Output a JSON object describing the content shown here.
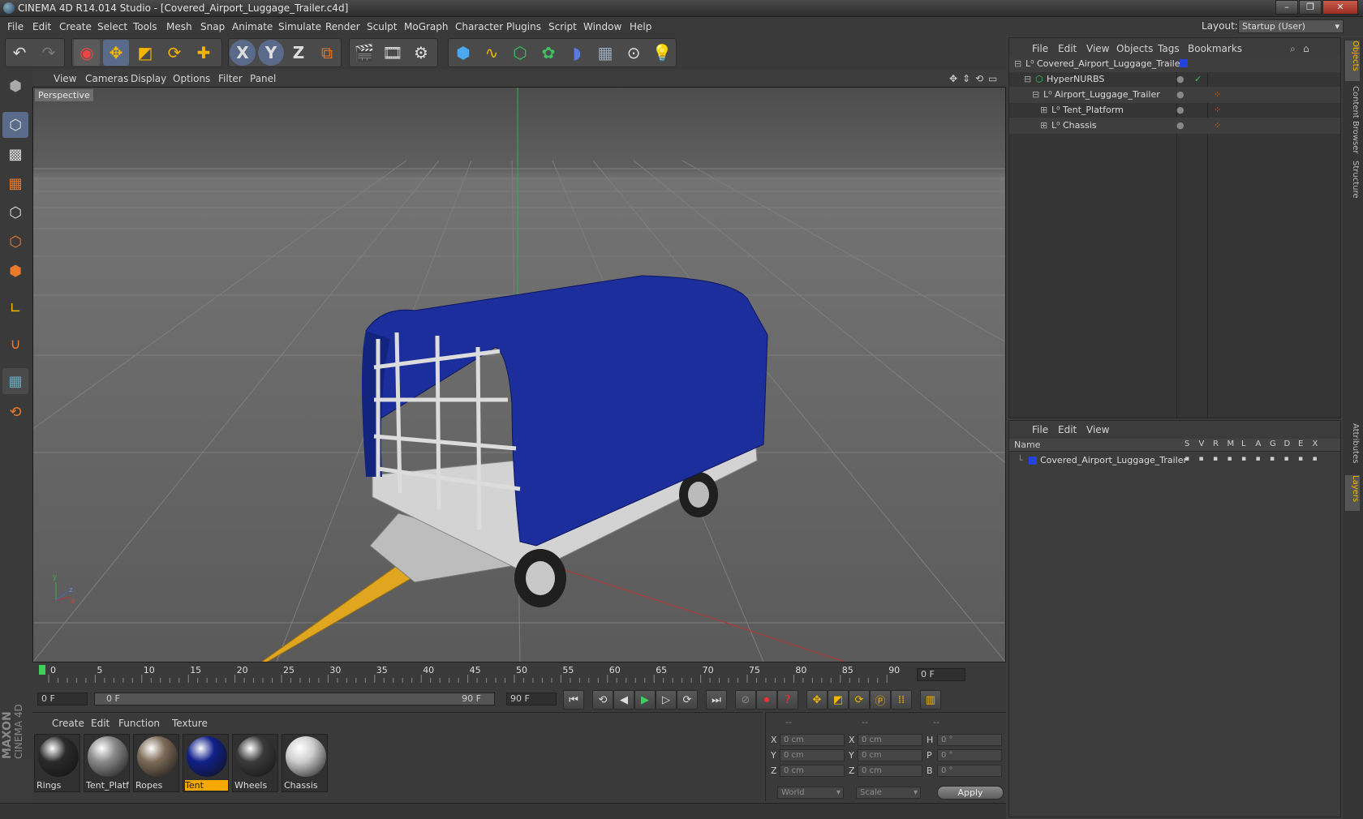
{
  "window": {
    "title": "CINEMA 4D R14.014 Studio - [Covered_Airport_Luggage_Trailer.c4d]"
  },
  "menu": [
    "File",
    "Edit",
    "Create",
    "Select",
    "Tools",
    "Mesh",
    "Snap",
    "Animate",
    "Simulate",
    "Render",
    "Sculpt",
    "MoGraph",
    "Character",
    "Plugins",
    "Script",
    "Window",
    "Help"
  ],
  "layout": {
    "label": "Layout:",
    "value": "Startup (User)"
  },
  "toolbar": {
    "x_label": "X",
    "y_label": "Y",
    "z_label": "Z"
  },
  "viewport": {
    "menu": [
      "View",
      "Cameras",
      "Display",
      "Options",
      "Filter",
      "Panel"
    ],
    "label": "Perspective",
    "axes": {
      "x": "x",
      "y": "y",
      "z": "z"
    }
  },
  "timeline": {
    "ticks": [
      "0",
      "5",
      "10",
      "15",
      "20",
      "25",
      "30",
      "35",
      "40",
      "45",
      "50",
      "55",
      "60",
      "65",
      "70",
      "75",
      "80",
      "85",
      "90"
    ],
    "current_frame": "0 F"
  },
  "transport": {
    "start": "0 F",
    "range_start": "0 F",
    "range_end": "90 F",
    "end": "90 F"
  },
  "materials": {
    "menu": [
      "Create",
      "Edit",
      "Function",
      "Texture"
    ],
    "items": [
      {
        "name": "Rings",
        "color": "#2a2a2a",
        "selected": false
      },
      {
        "name": "Tent_Platfo",
        "color": "#8a8a8a",
        "selected": false
      },
      {
        "name": "Ropes",
        "color": "#7d6b58",
        "selected": false
      },
      {
        "name": "Tent",
        "color": "#10208a",
        "selected": true
      },
      {
        "name": "Wheels",
        "color": "#3a3a3a",
        "selected": false
      },
      {
        "name": "Chassis",
        "color": "#cfcfcf",
        "selected": false
      }
    ]
  },
  "coords": {
    "headers": [
      "--",
      "--",
      "--"
    ],
    "pos": [
      {
        "axis": "X",
        "val": "0 cm"
      },
      {
        "axis": "Y",
        "val": "0 cm"
      },
      {
        "axis": "Z",
        "val": "0 cm"
      }
    ],
    "size": [
      {
        "axis": "X",
        "val": "0 cm"
      },
      {
        "axis": "Y",
        "val": "0 cm"
      },
      {
        "axis": "Z",
        "val": "0 cm"
      }
    ],
    "rot": [
      {
        "axis": "H",
        "val": "0 °"
      },
      {
        "axis": "P",
        "val": "0 °"
      },
      {
        "axis": "B",
        "val": "0 °"
      }
    ],
    "mode1": "World",
    "mode2": "Scale",
    "apply": "Apply"
  },
  "objects": {
    "menu": [
      "File",
      "Edit",
      "View",
      "Objects",
      "Tags",
      "Bookmarks"
    ],
    "rows": [
      {
        "name": "Covered_Airport_Luggage_Trailer"
      },
      {
        "name": "HyperNURBS"
      },
      {
        "name": "Airport_Luggage_Trailer"
      },
      {
        "name": "Tent_Platform"
      },
      {
        "name": "Chassis"
      }
    ]
  },
  "layers": {
    "menu": [
      "File",
      "Edit",
      "View"
    ],
    "header_name": "Name",
    "cols": [
      "S",
      "V",
      "R",
      "M",
      "L",
      "A",
      "G",
      "D",
      "E",
      "X"
    ],
    "row": "Covered_Airport_Luggage_Trailer"
  },
  "sidetabs": [
    "Objects",
    "Content Browser",
    "Structure",
    "Attributes",
    "Layers"
  ],
  "brand": {
    "maxon": "MAXON",
    "c4d": "CINEMA 4D"
  },
  "colors": {
    "tent": "#1b2e9c",
    "tongue": "#e0a620",
    "layer": "#2244dd"
  }
}
